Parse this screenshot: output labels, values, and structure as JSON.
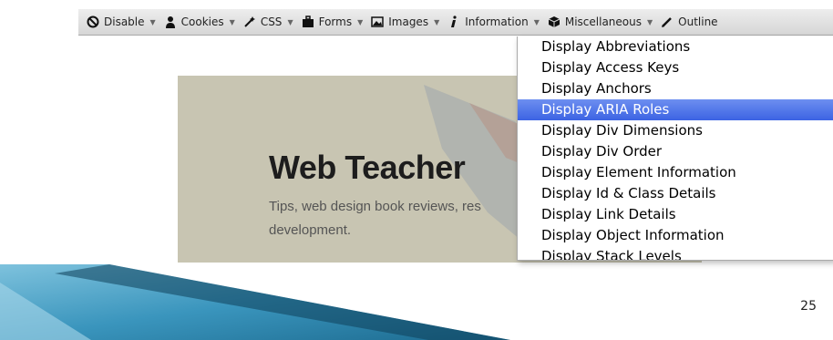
{
  "toolbar": {
    "items": [
      {
        "label": "Disable",
        "icon": "no-icon"
      },
      {
        "label": "Cookies",
        "icon": "person-icon"
      },
      {
        "label": "CSS",
        "icon": "wand-icon"
      },
      {
        "label": "Forms",
        "icon": "briefcase-icon"
      },
      {
        "label": "Images",
        "icon": "image-icon"
      },
      {
        "label": "Information",
        "icon": "info-icon"
      },
      {
        "label": "Miscellaneous",
        "icon": "box-icon"
      },
      {
        "label": "Outline",
        "icon": "pencil-icon"
      }
    ]
  },
  "page": {
    "title": "Web Teacher",
    "tagline": "Tips, web design book reviews, res",
    "tagline2": "development."
  },
  "menu": {
    "items": [
      "Display Abbreviations",
      "Display Access Keys",
      "Display Anchors",
      "Display ARIA Roles",
      "Display Div Dimensions",
      "Display Div Order",
      "Display Element Information",
      "Display Id & Class Details",
      "Display Link Details",
      "Display Object Information",
      "Display Stack Levels"
    ],
    "highlighted": "Display ARIA Roles"
  },
  "slide": {
    "number": "25"
  },
  "colors": {
    "highlight": "#3c63e3",
    "wedge": "#2a7fa6",
    "page_bg": "#c8c5b2"
  }
}
